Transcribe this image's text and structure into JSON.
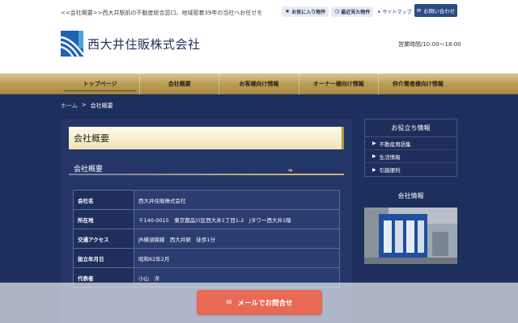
{
  "header": {
    "tagline": "<<会社概要>>西大井駅前の不動産総合窓口、地域密着39年の当社へお任せを",
    "favorites_label": "お気に入り物件",
    "recent_label": "最近見た物件",
    "sitemap_label": "サイトマップ",
    "contact_label": "お問い合わせ",
    "company_name": "西大井住販株式会社",
    "hours": "営業時間/10:00〜18:00"
  },
  "nav": {
    "items": [
      {
        "label": "トップページ"
      },
      {
        "label": "会社概要"
      },
      {
        "label": "お客様向け情報"
      },
      {
        "label": "オーナー様向け情報"
      },
      {
        "label": "仲介業者様向け情報"
      }
    ]
  },
  "breadcrumb": {
    "home": "ホーム",
    "separator": ">",
    "current": "会社概要"
  },
  "main": {
    "page_title": "会社概要",
    "section_title": "会社概要",
    "rows": [
      {
        "key": "会社名",
        "value": "西大井住販株式会社"
      },
      {
        "key": "所在地",
        "value": "〒140-0015　東京都品川区西大井1丁目1-2　Jタワー西大井1階"
      },
      {
        "key": "交通アクセス",
        "value": "JR横須賀線　西大井駅　徒歩1分"
      },
      {
        "key": "設立年月日",
        "value": "昭和62年2月"
      },
      {
        "key": "代表者",
        "value": "小山　洋"
      }
    ]
  },
  "sidebar": {
    "info_heading": "お役立ち情報",
    "links": [
      {
        "label": "不動産用語集"
      },
      {
        "label": "生活情報"
      },
      {
        "label": "引越便利"
      }
    ],
    "company_heading": "会社情報"
  },
  "footer": {
    "mail_button_label": "メールでお問合せ"
  },
  "colors": {
    "background": "#1d2f5c",
    "nav_gold": "#b89a55",
    "accent_button": "#e86a55",
    "header_button": "#2c4a86"
  }
}
